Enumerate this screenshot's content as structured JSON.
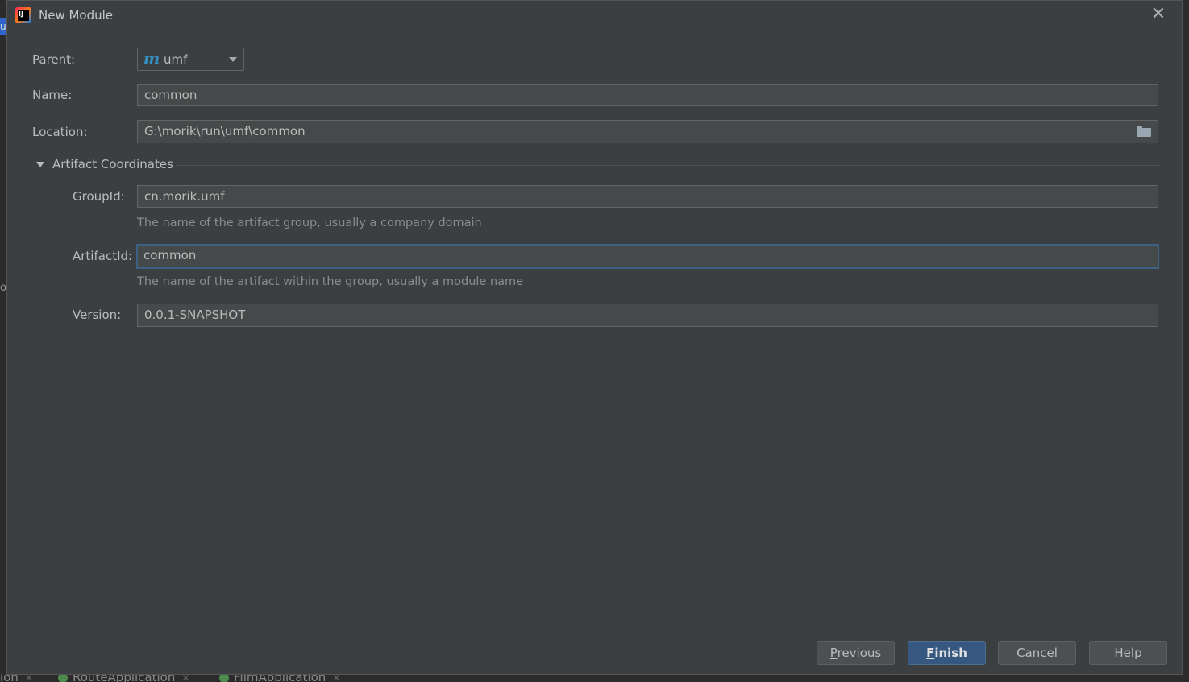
{
  "background": {
    "left_tab_text": "u",
    "left_side_char": "o",
    "bottom_tabs": [
      {
        "label": "ion"
      },
      {
        "label": "RouteApplication"
      },
      {
        "label": "FilmApplication"
      }
    ]
  },
  "dialog": {
    "title": "New Module",
    "close_glyph": "✕"
  },
  "form": {
    "parent": {
      "label": "Parent:",
      "icon_glyph": "m",
      "value": "umf"
    },
    "name": {
      "label": "Name:",
      "value": "common"
    },
    "location": {
      "label": "Location:",
      "value": "G:\\morik\\run\\umf\\common"
    }
  },
  "artifact_coordinates": {
    "title": "Artifact Coordinates",
    "expanded": true,
    "group_id": {
      "label": "GroupId:",
      "value": "cn.morik.umf",
      "hint": "The name of the artifact group, usually a company domain"
    },
    "artifact_id": {
      "label": "ArtifactId:",
      "value": "common",
      "hint": "The name of the artifact within the group, usually a module name"
    },
    "version": {
      "label": "Version:",
      "value": "0.0.1-SNAPSHOT"
    }
  },
  "buttons": {
    "previous": {
      "mnemonic": "P",
      "rest": "revious"
    },
    "finish": {
      "mnemonic": "F",
      "rest": "inish"
    },
    "cancel": {
      "label": "Cancel"
    },
    "help": {
      "label": "Help"
    }
  },
  "colors": {
    "dialog_bg": "#3c3f41",
    "field_bg": "#45494a",
    "focus_border": "#3d6185",
    "primary_button": "#365880",
    "maven_icon": "#3592c4"
  }
}
